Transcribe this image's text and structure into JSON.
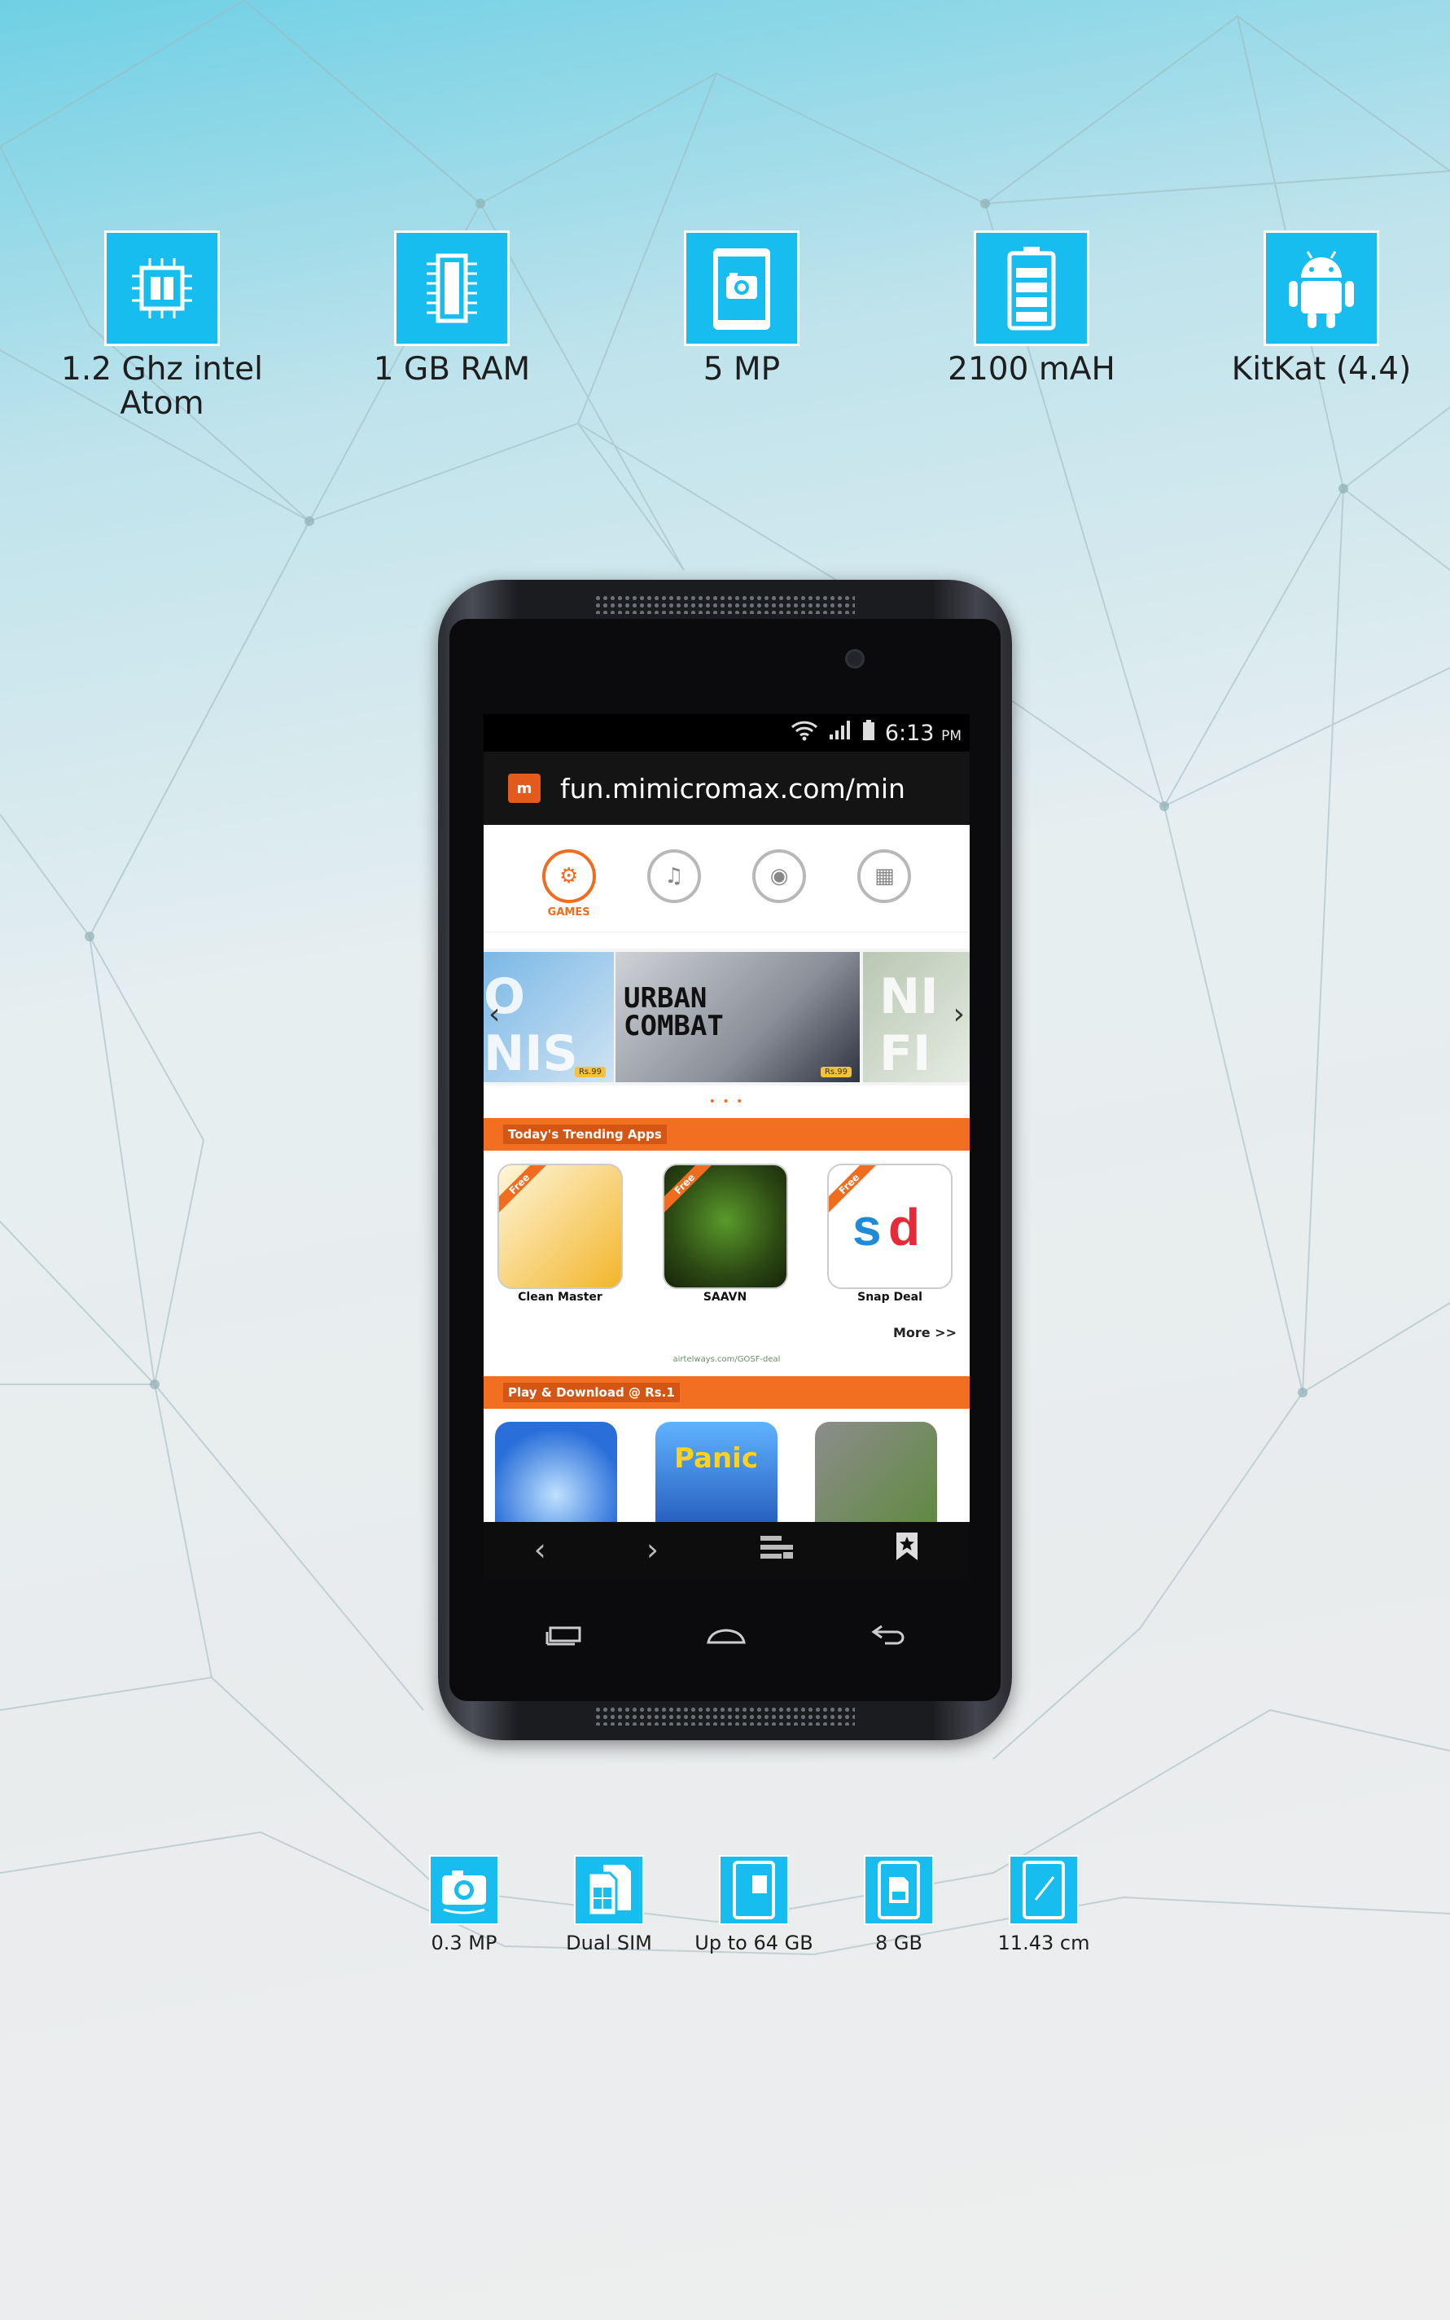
{
  "top_specs": [
    {
      "icon": "processor-chip-icon",
      "label": "1.2 Ghz intel Atom"
    },
    {
      "icon": "ram-module-icon",
      "label": "1 GB RAM"
    },
    {
      "icon": "rear-camera-icon",
      "label": "5 MP"
    },
    {
      "icon": "battery-icon",
      "label": "2100 mAH"
    },
    {
      "icon": "android-icon",
      "label": "KitKat (4.4)"
    }
  ],
  "phone": {
    "status_time": "6:13",
    "status_ampm": "PM",
    "url": "fun.mimicromax.com/min",
    "categories": [
      {
        "label": "GAMES",
        "active": true
      },
      {
        "label": "",
        "active": false
      },
      {
        "label": "",
        "active": false
      },
      {
        "label": "",
        "active": false
      }
    ],
    "carousel": {
      "left_text": "O\nNIS",
      "main_title": "URBAN\nCOMBAT",
      "main_price": "Rs.99",
      "left_price": "Rs.99",
      "right_text": "NI\nFI"
    },
    "dots": "• • •",
    "trending_banner": "Today's Trending Apps",
    "trending_apps": [
      {
        "name": "Clean Master",
        "ribbon": "Free",
        "color": "#f2b52b"
      },
      {
        "name": "SAAVN",
        "ribbon": "Free",
        "color": "#2d4a14"
      },
      {
        "name": "Snap Deal",
        "ribbon": "Free",
        "color": "#ffffff"
      }
    ],
    "more_link": "More >>",
    "ad_text": "airtelways.com/GOSF-deal",
    "play_banner": "Play & Download @ Rs.1",
    "play_apps": [
      {
        "name": "",
        "color": "#2a6fd9"
      },
      {
        "name": "Panic",
        "color": "#1c4fb3"
      },
      {
        "name": "",
        "color": "#5c8a3a"
      }
    ]
  },
  "bottom_specs": [
    {
      "icon": "front-camera-icon",
      "label": "0.3 MP"
    },
    {
      "icon": "dual-sim-icon",
      "label": "Dual SIM"
    },
    {
      "icon": "expandable-memory-icon",
      "label": "Up to 64 GB"
    },
    {
      "icon": "sd-card-icon",
      "label": "8 GB"
    },
    {
      "icon": "screen-size-icon",
      "label": "11.43 cm"
    }
  ]
}
